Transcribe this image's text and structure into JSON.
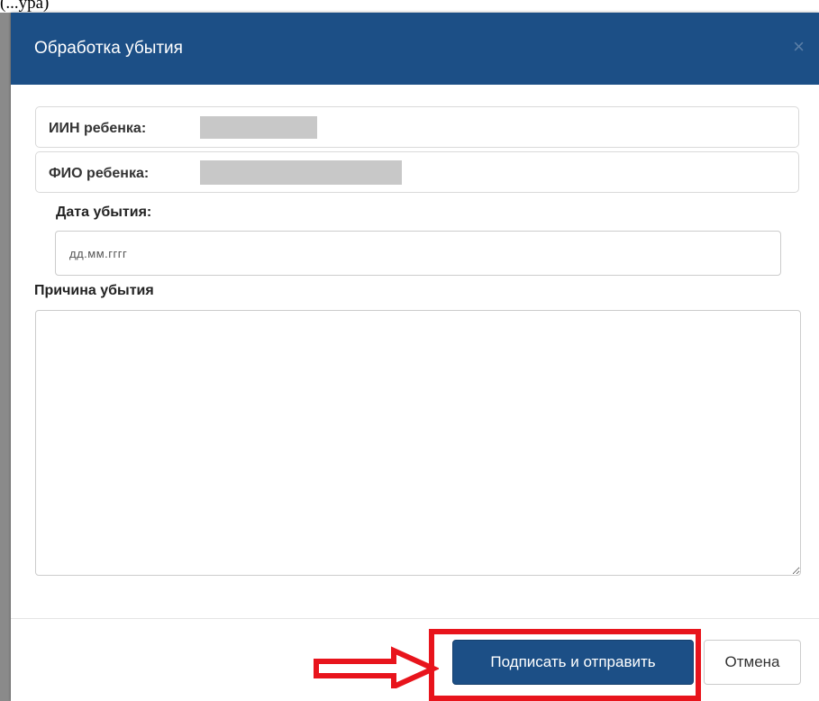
{
  "background": {
    "top_text": "(...ура)"
  },
  "modal": {
    "title": "Обработка убытия",
    "close_glyph": "×",
    "child_iin_label": "ИИН ребенка:",
    "child_name_label": "ФИО ребенка:",
    "departure_date_label": "Дата убытия:",
    "departure_date_placeholder": "дд.мм.гггг",
    "departure_date_value": "",
    "reason_label": "Причина убытия",
    "reason_value": "",
    "sign_and_send_label": "Подписать и отправить",
    "cancel_label": "Отмена"
  },
  "annotation": {
    "highlight_color": "#e8141c"
  },
  "colors": {
    "header": "#1c4f86",
    "primary_button": "#1c4f86"
  }
}
